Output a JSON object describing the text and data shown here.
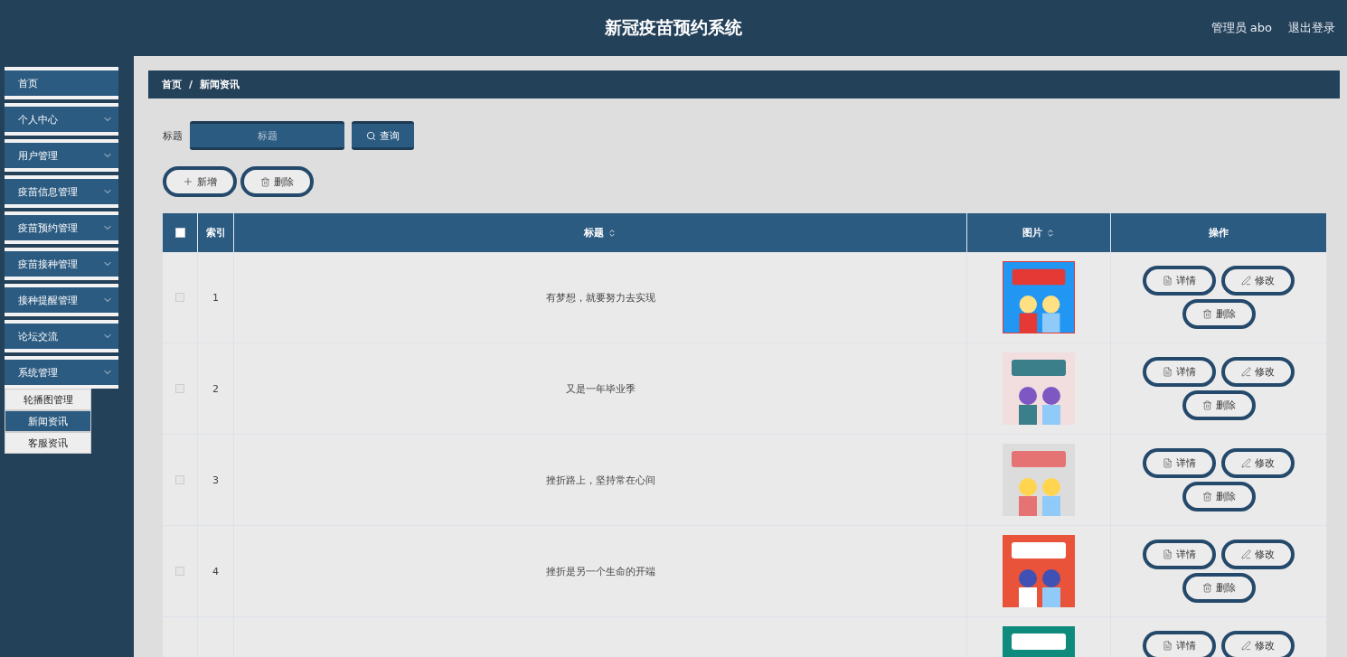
{
  "header": {
    "title": "新冠疫苗预约系统",
    "user": "管理员 abo",
    "logout": "退出登录"
  },
  "sidebar": {
    "items": [
      {
        "label": "首页",
        "kind": "link"
      },
      {
        "label": "个人中心",
        "kind": "group"
      },
      {
        "label": "用户管理",
        "kind": "group"
      },
      {
        "label": "疫苗信息管理",
        "kind": "group"
      },
      {
        "label": "疫苗预约管理",
        "kind": "group"
      },
      {
        "label": "疫苗接种管理",
        "kind": "group"
      },
      {
        "label": "接种提醒管理",
        "kind": "group"
      },
      {
        "label": "论坛交流",
        "kind": "group"
      },
      {
        "label": "系统管理",
        "kind": "group",
        "expanded": true,
        "children": [
          {
            "label": "轮播图管理",
            "selected": false
          },
          {
            "label": "新闻资讯",
            "selected": true
          },
          {
            "label": "客服资讯",
            "selected": false
          }
        ]
      }
    ]
  },
  "breadcrumb": [
    "首页",
    "/",
    "新闻资讯"
  ],
  "search": {
    "label": "标题",
    "placeholder": "标题",
    "button": "查询"
  },
  "actions": {
    "add": "新增",
    "delete": "删除"
  },
  "table": {
    "header_checked": false,
    "columns": [
      {
        "label": "索引",
        "sortable": false
      },
      {
        "label": "标题",
        "sortable": true
      },
      {
        "label": "图片",
        "sortable": true
      },
      {
        "label": "操作",
        "sortable": false
      }
    ],
    "rows": [
      {
        "checked": false,
        "index": "1",
        "title": "有梦想，就要努力去实现",
        "picture": {
          "kind": "picture",
          "bordered": true
        },
        "buttons": [
          "详情",
          "修改",
          "删除"
        ]
      },
      {
        "checked": false,
        "index": "2",
        "title": "又是一年毕业季",
        "picture": {
          "kind": "picture",
          "bordered": false
        },
        "buttons": [
          "详情",
          "修改",
          "删除"
        ]
      },
      {
        "checked": false,
        "index": "3",
        "title": "挫折路上，坚持常在心间",
        "picture": {
          "kind": "picture",
          "bordered": false
        },
        "buttons": [
          "详情",
          "修改",
          "删除"
        ]
      },
      {
        "checked": false,
        "index": "4",
        "title": "挫折是另一个生命的开端",
        "picture": {
          "kind": "picture",
          "bordered": false
        },
        "buttons": [
          "详情",
          "修改",
          "删除"
        ]
      },
      {
        "picture": {
          "kind": "picture",
          "bordered": false
        },
        "buttons": [
          "详情",
          "修改"
        ]
      }
    ]
  }
}
